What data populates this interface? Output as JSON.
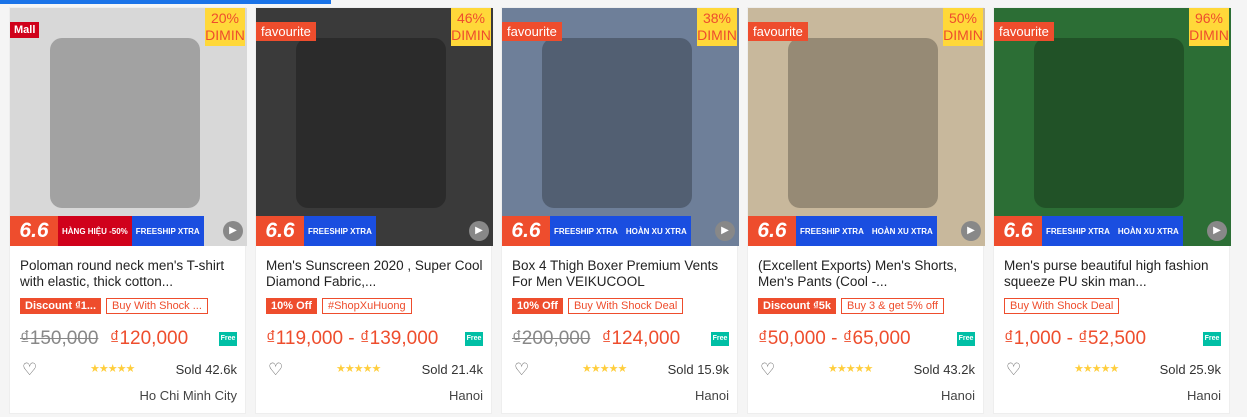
{
  "products": [
    {
      "badge_type": "mall",
      "badge": "Mall",
      "discount": "20%",
      "discount_label": "DIMIN",
      "promo_66": "6.6",
      "promo_a": "HÀNG HIỆU -50%",
      "promo_b": "FREESHIP XTRA",
      "title": "Poloman round neck men's T-shirt with elastic, thick cotton...",
      "tag1": "Discount ₫1...",
      "tag2": "Buy With Shock ...",
      "orig_price": "₫150,000",
      "price": "₫120,000",
      "sold": "Sold 42.6k",
      "location": "Ho Chi Minh City",
      "img_color": "#d8d8d8"
    },
    {
      "badge_type": "fav",
      "badge": "favourite",
      "discount": "46%",
      "discount_label": "DIMIN",
      "promo_66": "6.6",
      "promo_a": "FREESHIP XTRA",
      "promo_b": "",
      "title": "Men's Sunscreen 2020 , Super Cool Diamond Fabric,...",
      "tag1": "10% Off",
      "tag2": "#ShopXuHuong",
      "orig_price": "",
      "price": "₫119,000 - ₫139,000",
      "sold": "Sold 21.4k",
      "location": "Hanoi",
      "img_color": "#3a3a3a"
    },
    {
      "badge_type": "fav",
      "badge": "favourite",
      "discount": "38%",
      "discount_label": "DIMIN",
      "promo_66": "6.6",
      "promo_a": "FREESHIP XTRA",
      "promo_b": "HOÀN XU XTRA",
      "title": "Box 4 Thigh Boxer Premium Vents For Men VEIKUCOOL",
      "tag1": "10% Off",
      "tag2": "Buy With Shock Deal",
      "orig_price": "₫200,000",
      "price": "₫124,000",
      "sold": "Sold 15.9k",
      "location": "Hanoi",
      "img_color": "#6e7f99"
    },
    {
      "badge_type": "fav",
      "badge": "favourite",
      "discount": "50%",
      "discount_label": "DIMIN",
      "promo_66": "6.6",
      "promo_a": "FREESHIP XTRA",
      "promo_b": "HOÀN XU XTRA",
      "title": "(Excellent Exports) Men's Shorts, Men's Pants (Cool -...",
      "tag1": "Discount ₫5k",
      "tag2": "Buy 3 & get 5% off",
      "orig_price": "",
      "price": "₫50,000 - ₫65,000",
      "sold": "Sold 43.2k",
      "location": "Hanoi",
      "img_color": "#c8b89c"
    },
    {
      "badge_type": "fav",
      "badge": "favourite",
      "discount": "96%",
      "discount_label": "DIMIN",
      "promo_66": "6.6",
      "promo_a": "FREESHIP XTRA",
      "promo_b": "HOÀN XU XTRA",
      "title": "Men's purse beautiful high fashion squeeze PU skin man...",
      "tag1": "",
      "tag2": "Buy With Shock Deal",
      "orig_price": "",
      "price": "₫1,000 - ₫52,500",
      "sold": "Sold 25.9k",
      "location": "Hanoi",
      "img_color": "#2c6e35"
    }
  ],
  "colors": {
    "accent": "#ee4d2d",
    "stars": "#ffce3d",
    "freeship": "#00bfa5"
  },
  "icons": {
    "heart": "heart-icon",
    "play": "play-icon",
    "freeship": "freeship-icon",
    "star": "star-icon"
  }
}
